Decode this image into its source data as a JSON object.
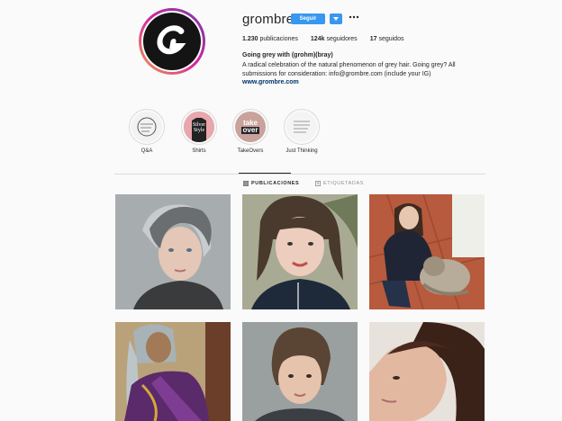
{
  "profile": {
    "username": "grombre",
    "follow_label": "Seguir",
    "stats": {
      "posts_count": "1.230",
      "posts_label": "publicaciones",
      "followers_count": "124k",
      "followers_label": "seguidores",
      "following_count": "17",
      "following_label": "seguidos"
    },
    "full_name": "Going grey with (grohm)(bray)",
    "bio_line1": "A radical celebration of the natural phenomenon of grey hair. Going grey? All",
    "bio_line2": "submissions for consideration: info@grombre.com (include your IG)",
    "website": "www.grombre.com",
    "avatar_letter": "G"
  },
  "highlights": [
    {
      "label": "Q&A"
    },
    {
      "label": "Shirts",
      "img_text1": "Silver",
      "img_text2": "Style"
    },
    {
      "label": "TakeOvers",
      "img_text1": "take",
      "img_text2": "over"
    },
    {
      "label": "Just Thinking"
    }
  ],
  "tabs": {
    "posts": "PUBLICACIONES",
    "tagged": "ETIQUETADAS"
  },
  "colors": {
    "accent": "#3897f0",
    "link": "#003569"
  },
  "icons": {
    "dropdown": "triangle-down-icon",
    "more": "ellipsis-icon",
    "grid": "grid-icon",
    "tagged": "tag-icon"
  }
}
